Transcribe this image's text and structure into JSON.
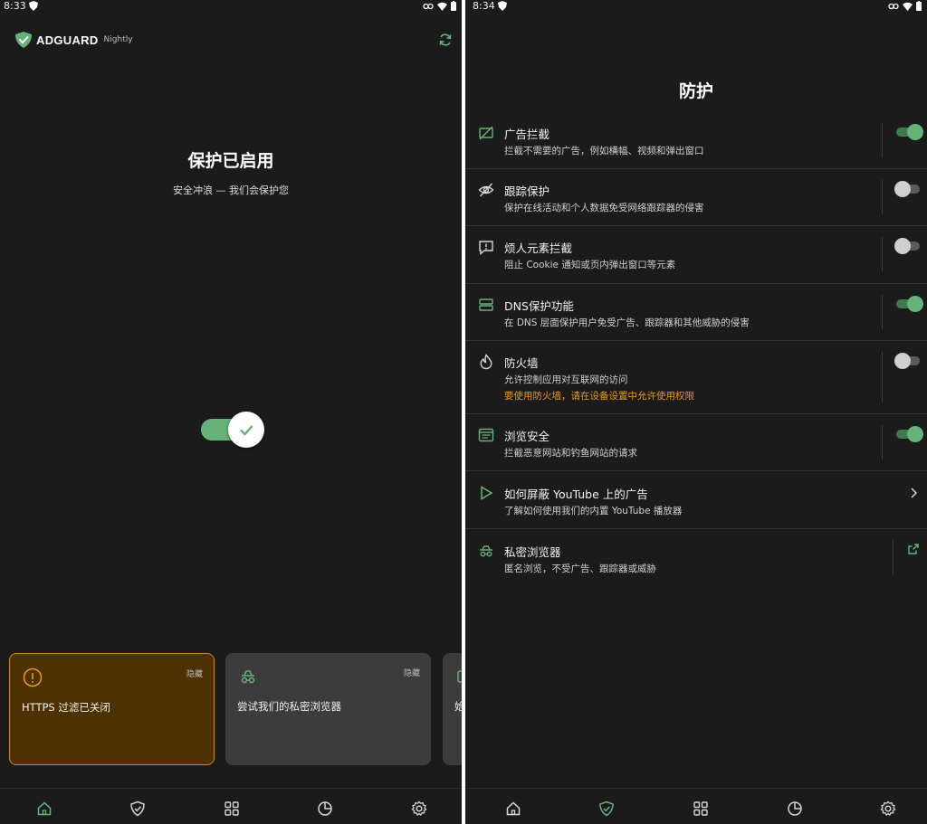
{
  "left": {
    "status": {
      "time": "8:33"
    },
    "brand": {
      "name": "ADGUARD",
      "edition": "Nightly"
    },
    "protection": {
      "title": "保护已启用",
      "subtitle": "安全冲浪 — 我们会保护您",
      "enabled": true
    },
    "cards": [
      {
        "text": "HTTPS 过滤已关闭",
        "hide": "隐藏",
        "icon": "info-icon"
      },
      {
        "text": "尝试我们的私密浏览器",
        "hide": "隐藏",
        "icon": "incognito-icon"
      },
      {
        "text": "始",
        "icon": "card-icon"
      }
    ]
  },
  "right": {
    "status": {
      "time": "8:34"
    },
    "title": "防护",
    "items": [
      {
        "title": "广告拦截",
        "desc": "拦截不需要的广告，例如横幅、视频和弹出窗口",
        "on": true,
        "icon": "ad-block-icon"
      },
      {
        "title": "跟踪保护",
        "desc": "保护在线活动和个人数据免受网络跟踪器的侵害",
        "on": false,
        "icon": "tracking-icon"
      },
      {
        "title": "烦人元素拦截",
        "desc": "阻止 Cookie 通知或页内弹出窗口等元素",
        "on": false,
        "icon": "annoyance-icon"
      },
      {
        "title": "DNS保护功能",
        "desc": "在 DNS 层面保护用户免受广告、跟踪器和其他威胁的侵害",
        "on": true,
        "icon": "dns-icon"
      },
      {
        "title": "防火墙",
        "desc": "允许控制应用对互联网的访问",
        "warning": "要使用防火墙，请在设备设置中允许使用权限",
        "on": false,
        "icon": "firewall-icon"
      },
      {
        "title": "浏览安全",
        "desc": "拦截恶意网站和钓鱼网站的请求",
        "on": true,
        "icon": "browsing-security-icon"
      },
      {
        "title": "如何屏蔽 YouTube 上的广告",
        "desc": "了解如何使用我们的内置 YouTube 播放器",
        "icon": "play-icon"
      },
      {
        "title": "私密浏览器",
        "desc": "匿名浏览，不受广告、跟踪器或威胁",
        "icon": "incognito-icon"
      }
    ]
  },
  "colors": {
    "accent": "#67b279",
    "background": "#1b1b1b",
    "warning": "#e89a16",
    "card_warning_bg": "#4d3100"
  }
}
